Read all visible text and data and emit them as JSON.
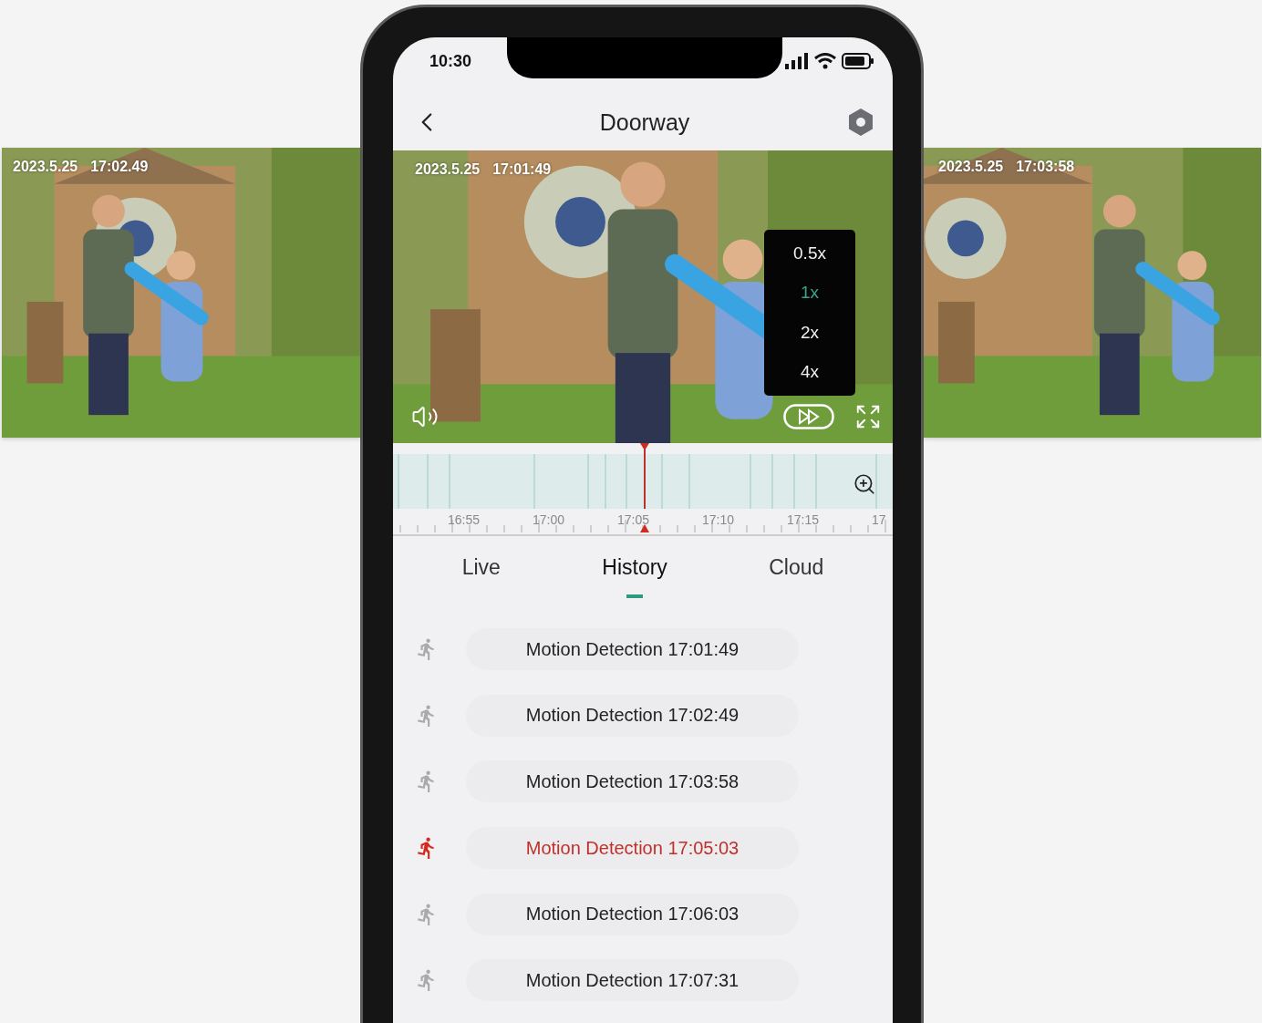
{
  "side_clips": [
    {
      "date": "2023.5.25",
      "time": "17:02.49"
    },
    {
      "date": "2023.5.25",
      "time": "17:03:58"
    }
  ],
  "status_bar": {
    "time": "10:30"
  },
  "header": {
    "title": "Doorway"
  },
  "video": {
    "date": "2023.5.25",
    "time": "17:01:49",
    "speed_menu": [
      {
        "label": "0.5x",
        "selected": false
      },
      {
        "label": "1x",
        "selected": true
      },
      {
        "label": "2x",
        "selected": false
      },
      {
        "label": "4x",
        "selected": false
      }
    ]
  },
  "timeline": {
    "labels": [
      "16:55",
      "17:00",
      "17:05",
      "17:10",
      "17:15",
      "17"
    ]
  },
  "tabs": [
    {
      "label": "Live",
      "selected": false
    },
    {
      "label": "History",
      "selected": true
    },
    {
      "label": "Cloud",
      "selected": false
    }
  ],
  "events": [
    {
      "label": "Motion Detection 17:01:49",
      "selected": false
    },
    {
      "label": "Motion Detection 17:02:49",
      "selected": false
    },
    {
      "label": "Motion Detection 17:03:58",
      "selected": false
    },
    {
      "label": "Motion Detection 17:05:03",
      "selected": true
    },
    {
      "label": "Motion Detection 17:06:03",
      "selected": false
    },
    {
      "label": "Motion Detection 17:07:31",
      "selected": false
    }
  ]
}
